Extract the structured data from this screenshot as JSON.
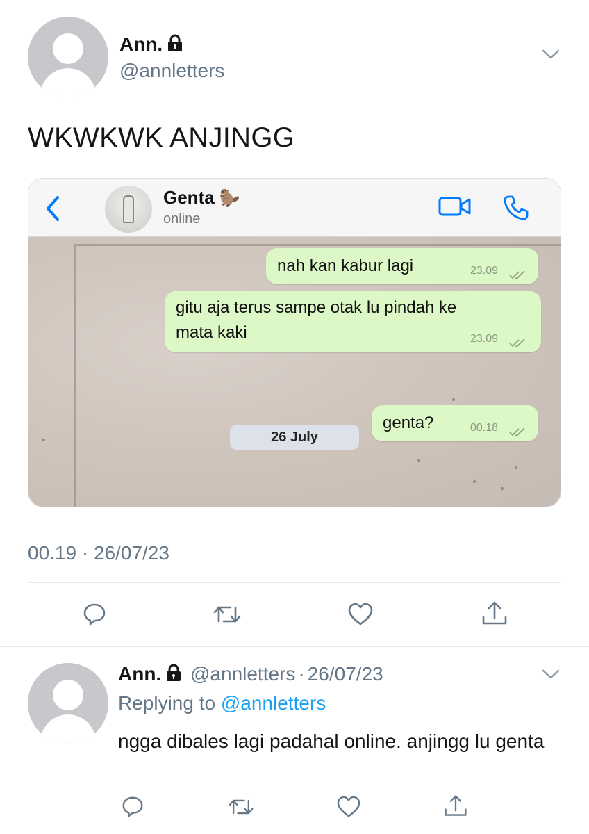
{
  "main_tweet": {
    "name": "Ann.",
    "handle": "@annletters",
    "text": "WKWKWK ANJINGG",
    "timestamp": "00.19 · 26/07/23"
  },
  "chat_screenshot": {
    "contact_name": "Genta",
    "contact_emoji": "🦫",
    "status": "online",
    "messages": [
      {
        "text": "nah kan kabur lagi",
        "time": "23.09"
      },
      {
        "text_line1": "gitu aja terus sampe otak lu pindah ke",
        "text_line2": "mata kaki",
        "time": "23.09"
      },
      {
        "text": "genta?",
        "time": "00.18"
      }
    ],
    "date_separator": "26 July"
  },
  "reply_tweet": {
    "name": "Ann.",
    "handle": "@annletters",
    "separator": "·",
    "date": "26/07/23",
    "replying_to_label": "Replying to",
    "replying_to_handle": "@annletters",
    "text": "ngga dibales lagi padahal online. anjingg lu genta"
  },
  "colors": {
    "accent": "#1da1f2",
    "secondary_text": "#657786",
    "ios_blue": "#007aff",
    "bubble": "#dcf8c6"
  },
  "icons": [
    "lock-icon",
    "chevron-down-icon",
    "back-icon",
    "video-call-icon",
    "phone-icon",
    "reply-icon",
    "retweet-icon",
    "like-icon",
    "share-icon",
    "double-check-icon"
  ]
}
